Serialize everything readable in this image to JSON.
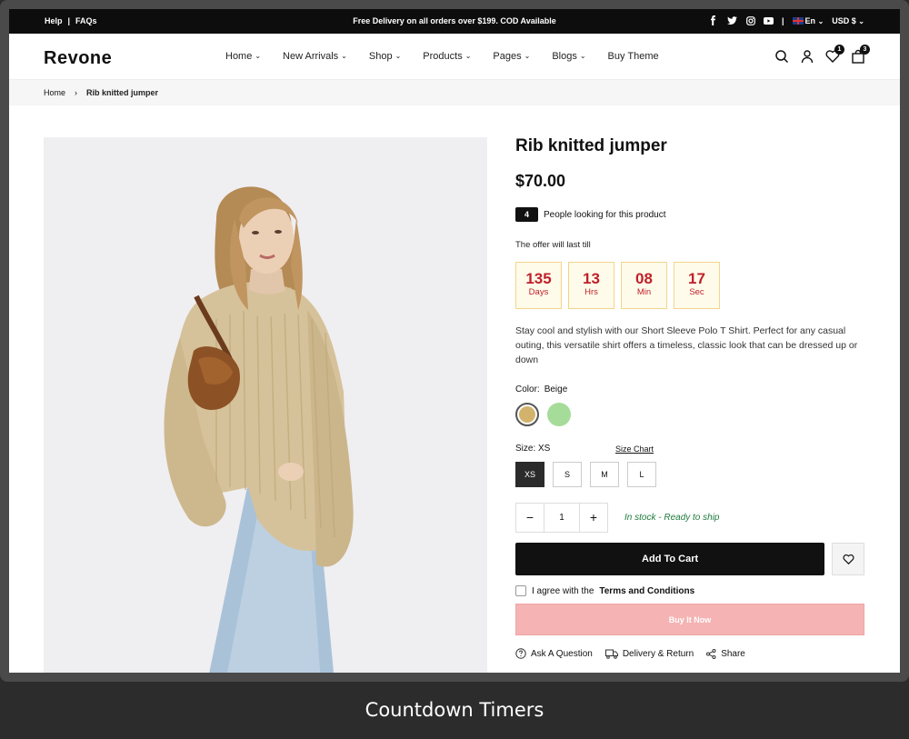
{
  "topbar": {
    "help": "Help",
    "separator": "|",
    "faqs": "FAQs",
    "promo": "Free Delivery on all orders over $199. COD Available",
    "language": "En",
    "currency": "USD $"
  },
  "header": {
    "logo": "Revone",
    "nav": [
      {
        "label": "Home"
      },
      {
        "label": "New Arrivals"
      },
      {
        "label": "Shop"
      },
      {
        "label": "Products"
      },
      {
        "label": "Pages"
      },
      {
        "label": "Blogs"
      },
      {
        "label": "Buy Theme"
      }
    ],
    "wishlist_count": "1",
    "cart_count": "3"
  },
  "breadcrumb": {
    "home": "Home",
    "current": "Rib knitted jumper"
  },
  "product": {
    "title": "Rib knitted jumper",
    "price": "$70.00",
    "looking_count": "4",
    "looking_text": "People looking for this product",
    "offer_text": "The offer will last till",
    "timer": [
      {
        "value": "135",
        "unit": "Days"
      },
      {
        "value": "13",
        "unit": "Hrs"
      },
      {
        "value": "08",
        "unit": "Min"
      },
      {
        "value": "17",
        "unit": "Sec"
      }
    ],
    "description": "Stay cool and stylish with our Short Sleeve Polo T Shirt. Perfect for any casual outing, this versatile shirt offers a timeless, classic look that can be dressed up or down",
    "color_label": "Color:",
    "color_value": "Beige",
    "colors": [
      "#d3b36c",
      "#a6dc9a"
    ],
    "size_label": "Size:",
    "size_value": "XS",
    "size_chart": "Size Chart",
    "sizes": [
      "XS",
      "S",
      "M",
      "L"
    ],
    "quantity": "1",
    "qty_minus": "−",
    "qty_plus": "+",
    "stock": "In stock - Ready to ship",
    "add_to_cart": "Add To Cart",
    "agree_text": "I agree with the",
    "terms": "Terms and Conditions",
    "buy_now": "Buy It Now",
    "actions": [
      "Ask A Question",
      "Delivery & Return",
      "Share"
    ]
  },
  "caption": "Countdown Timers"
}
